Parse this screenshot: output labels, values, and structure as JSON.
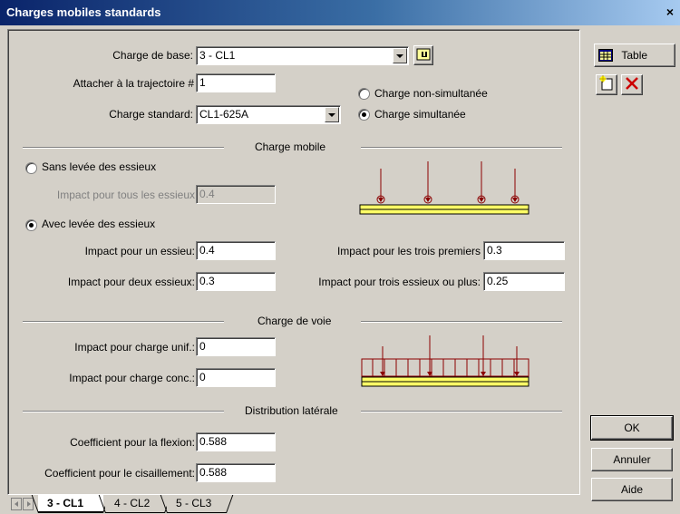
{
  "window": {
    "title": "Charges mobiles standards",
    "close_glyph": "×"
  },
  "top": {
    "charge_de_base_label": "Charge de base:",
    "charge_de_base_value": "3 - CL1",
    "attacher_label": "Attacher à la trajectoire #",
    "attacher_value": "1",
    "charge_standard_label": "Charge standard:",
    "charge_standard_value": "CL1-625A",
    "radio_non_simultanee": "Charge non-simultanée",
    "radio_simultanee": "Charge simultanée",
    "selected_mode": "simultanee"
  },
  "charge_mobile": {
    "header": "Charge mobile",
    "radio_sans_levee": "Sans levée des essieux",
    "impact_tous_label": "Impact pour tous les essieux",
    "impact_tous_value": "0.4",
    "radio_avec_levee": "Avec levée des essieux",
    "selected": "avec",
    "impact_un_label": "Impact pour un essieu:",
    "impact_un_value": "0.4",
    "impact_deux_label": "Impact pour deux essieux:",
    "impact_deux_value": "0.3",
    "impact_trois_premiers_label": "Impact pour les trois premiers",
    "impact_trois_premiers_value": "0.3",
    "impact_trois_plus_label": "Impact pour trois essieux ou plus:",
    "impact_trois_plus_value": "0.25"
  },
  "charge_voie": {
    "header": "Charge de voie",
    "unif_label": "Impact pour charge unif.:",
    "unif_value": "0",
    "conc_label": "Impact pour charge conc.:",
    "conc_value": "0"
  },
  "distribution": {
    "header": "Distribution latérale",
    "flexion_label": "Coefficient pour la flexion:",
    "flexion_value": "0.588",
    "cisaillement_label": "Coefficient pour le cisaillement:",
    "cisaillement_value": "0.588"
  },
  "side": {
    "table_label": "Table",
    "ok_label": "OK",
    "annuler_label": "Annuler",
    "aide_label": "Aide"
  },
  "tabs": [
    {
      "label": "3 - CL1",
      "active": true
    },
    {
      "label": "4 - CL2",
      "active": false
    },
    {
      "label": "5 - CL3",
      "active": false
    }
  ],
  "colors": {
    "beam_fill": "#ffff66",
    "load_red": "#8b0000",
    "title_start": "#0a246a",
    "title_end": "#a6caf0"
  }
}
